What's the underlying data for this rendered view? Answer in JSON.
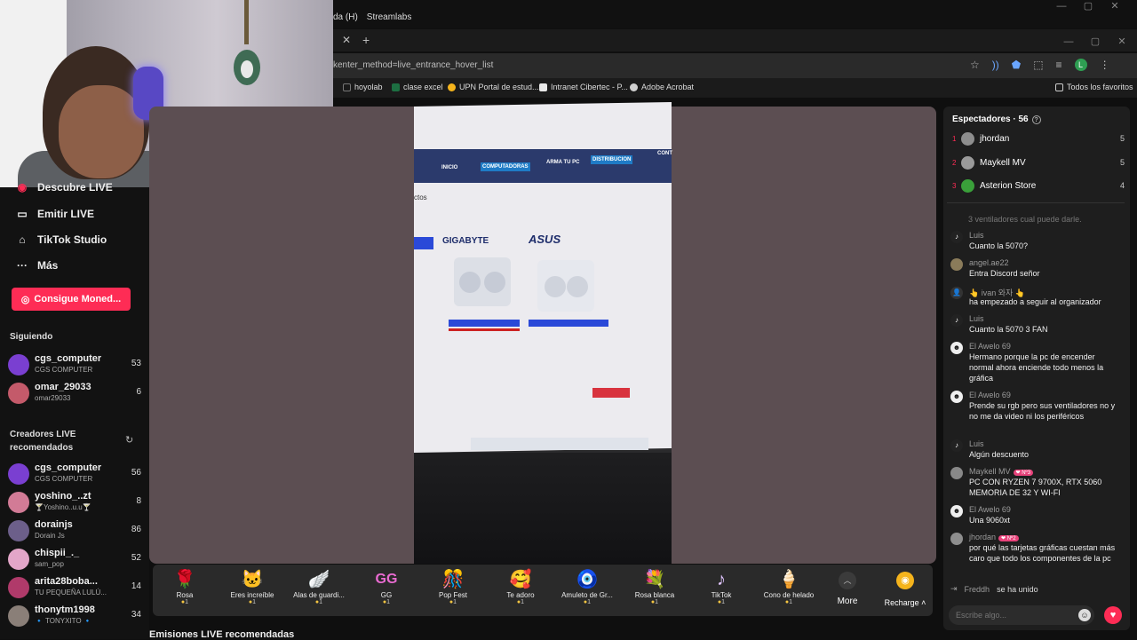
{
  "browser": {
    "obs_menu": [
      "da (H)",
      "Streamlabs"
    ],
    "url": "kenter_method=live_entrance_hover_list",
    "bookmarks": [
      {
        "label": "hoyolab",
        "color": "#1a1a1a"
      },
      {
        "label": "clase excel",
        "color": "#1d6f42"
      },
      {
        "label": "UPN Portal de estud...",
        "color": "#f5b41c"
      },
      {
        "label": "Intranet Cibertec - P...",
        "color": "#e8e8e8"
      },
      {
        "label": "Adobe Acrobat",
        "color": "#d0d0d0"
      }
    ],
    "all_bookmarks": "Todos los favoritos",
    "avatar_letter": "L"
  },
  "sidebar": {
    "partial_item": "Descubre LIVE",
    "nav": [
      {
        "label": "Emitir LIVE",
        "icon": "video-camera-icon"
      },
      {
        "label": "TikTok Studio",
        "icon": "home-studio-icon"
      },
      {
        "label": "Más",
        "icon": "more-dots-icon"
      }
    ],
    "coins_button": "Consigue Moned...",
    "following_title": "Siguiendo",
    "following": [
      {
        "name": "cgs_computer",
        "sub": "CGS COMPUTER",
        "count": "53",
        "color": "#7a3fd1"
      },
      {
        "name": "omar_29033",
        "sub": "omar29033",
        "count": "6",
        "color": "#c45a6a"
      }
    ],
    "recommended_title": "Creadores LIVE recomendados",
    "recommended": [
      {
        "name": "cgs_computer",
        "sub": "CGS COMPUTER",
        "count": "56",
        "color": "#7a3fd1"
      },
      {
        "name": "yoshino_..zt",
        "sub": "🍸Yoshino..u.u🍸",
        "count": "8",
        "color": "#d27b96"
      },
      {
        "name": "dorainjs",
        "sub": "Dorain Js",
        "count": "86",
        "color": "#6c5f8a"
      },
      {
        "name": "chispii_._",
        "sub": "sam_pop",
        "count": "52",
        "color": "#e3a6c9"
      },
      {
        "name": "arita28boba...",
        "sub": "TU PEQUEÑA LULÚ...",
        "count": "14",
        "color": "#b03a6a"
      },
      {
        "name": "thonytm1998",
        "sub": "🔹 TONYXITO 🔹",
        "count": "34",
        "color": "#8a7f78"
      }
    ]
  },
  "video": {
    "brand_left": "GIGABYTE",
    "brand_right": "ASUS",
    "section": "ctos",
    "nav_items": [
      "INICIO",
      "COMPUTADORAS",
      "ARMA TU PC",
      "DISTRIBUCION",
      "CONT"
    ]
  },
  "gifts": [
    {
      "name": "Rosa",
      "cost": "1",
      "icon": "🌹"
    },
    {
      "name": "Eres increíble",
      "cost": "1",
      "icon": "🐱"
    },
    {
      "name": "Alas de guardi...",
      "cost": "1",
      "icon": "🪽"
    },
    {
      "name": "GG",
      "cost": "1",
      "icon": "GG"
    },
    {
      "name": "Pop Fest",
      "cost": "1",
      "icon": "🎊"
    },
    {
      "name": "Te adoro",
      "cost": "1",
      "icon": "🥰"
    },
    {
      "name": "Amuleto de Gr...",
      "cost": "1",
      "icon": "🧿"
    },
    {
      "name": "Rosa blanca",
      "cost": "1",
      "icon": "💐"
    },
    {
      "name": "TikTok",
      "cost": "1",
      "icon": "♪"
    },
    {
      "name": "Cono de helado",
      "cost": "1",
      "icon": "🍦"
    }
  ],
  "gift_bar": {
    "more": "More",
    "recharge": "Recharge"
  },
  "recommended_heading": "Emisiones LIVE recomendadas",
  "chat": {
    "viewers_title": "Espectadores · 56",
    "top_viewers": [
      {
        "rank": "1",
        "name": "jhordan",
        "count": "5",
        "color": "#8e8e8e"
      },
      {
        "rank": "2",
        "name": "Maykell MV",
        "count": "5",
        "color": "#9a9a9a"
      },
      {
        "rank": "3",
        "name": "Asterion Store",
        "count": "4",
        "color": "#3aa03a"
      }
    ],
    "faded_text": "3 ventiladores cual puede darle.",
    "messages": [
      {
        "user": "Luis",
        "badge": "",
        "text": "Cuanto la 5070?",
        "avatar": "♪"
      },
      {
        "user": "angel.ae22",
        "badge": "",
        "text": "Entra Discord señor",
        "avatar": ""
      },
      {
        "user": "👆 ivan 와자 👆",
        "badge": "",
        "text": "ha empezado a seguir al organizador",
        "avatar": "👤"
      },
      {
        "user": "Luis",
        "badge": "",
        "text": "Cuanto la 5070 3 FAN",
        "avatar": "♪"
      },
      {
        "user": "El Awelo 69",
        "badge": "",
        "text": "Hermano porque la pc de encender normal ahora enciende todo menos la gráfica",
        "avatar": "☻"
      },
      {
        "user": "El Awelo 69",
        "badge": "",
        "text": "Prende su rgb pero sus ventiladores no y no me da video ni los periféricos",
        "avatar": "☻"
      },
      {
        "user": "Luis",
        "badge": "",
        "text": "Algún descuento",
        "avatar": "♪"
      },
      {
        "user": "Maykell MV",
        "badge": "❤ Nº3",
        "text": "PC CON RYZEN 7 9700X, RTX 5060 MEMORIA DE 32 Y WI-FI",
        "avatar": ""
      },
      {
        "user": "El Awelo 69",
        "badge": "",
        "text": "Una 9060xt",
        "avatar": "☻"
      },
      {
        "user": "jhordan",
        "badge": "❤ Nº2",
        "text": "por qué las tarjetas gráficas cuestan más caro que todo los componentes de la pc",
        "avatar": ""
      }
    ],
    "joined_user": "Freddh",
    "joined_text": "se ha unido",
    "input_placeholder": "Escribe algo..."
  }
}
